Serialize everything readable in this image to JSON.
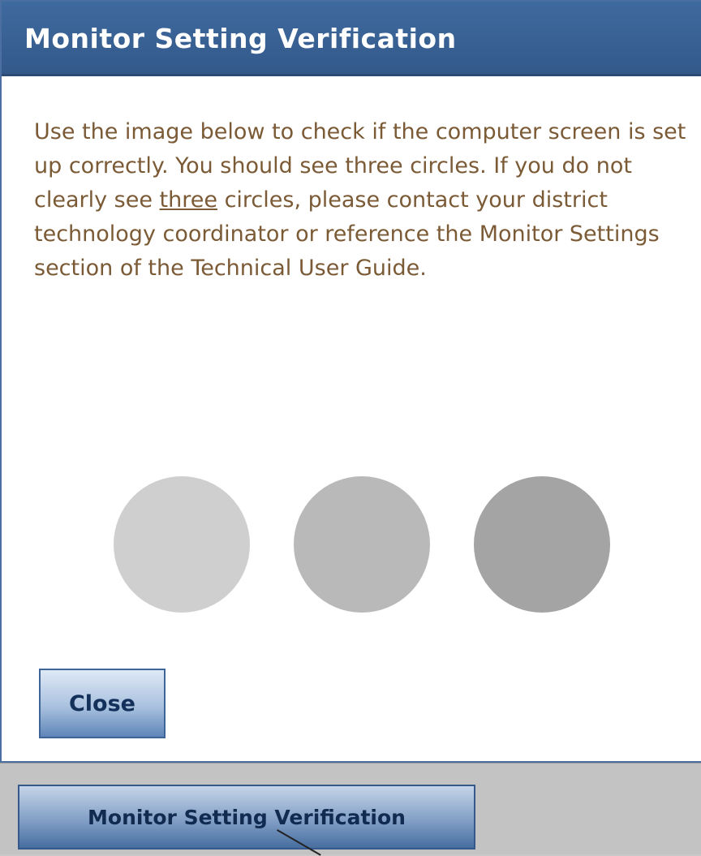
{
  "dialog": {
    "title": "Monitor Setting Verification",
    "message_before": "Use the image below to check if the computer screen is set up correctly. You should see three circles. If you do not clearly see ",
    "message_emphasis": "three",
    "message_after": " circles, please contact your district technology coordinator or reference the Monitor Settings section of the Technical User Guide.",
    "circles": [
      {
        "name": "circle-light",
        "color": "#cfcfcf"
      },
      {
        "name": "circle-medium",
        "color": "#b9b9b9"
      },
      {
        "name": "circle-dark",
        "color": "#a4a4a4"
      }
    ],
    "close_label": "Close"
  },
  "taskbar": {
    "button_label": "Monitor Setting Verification"
  }
}
